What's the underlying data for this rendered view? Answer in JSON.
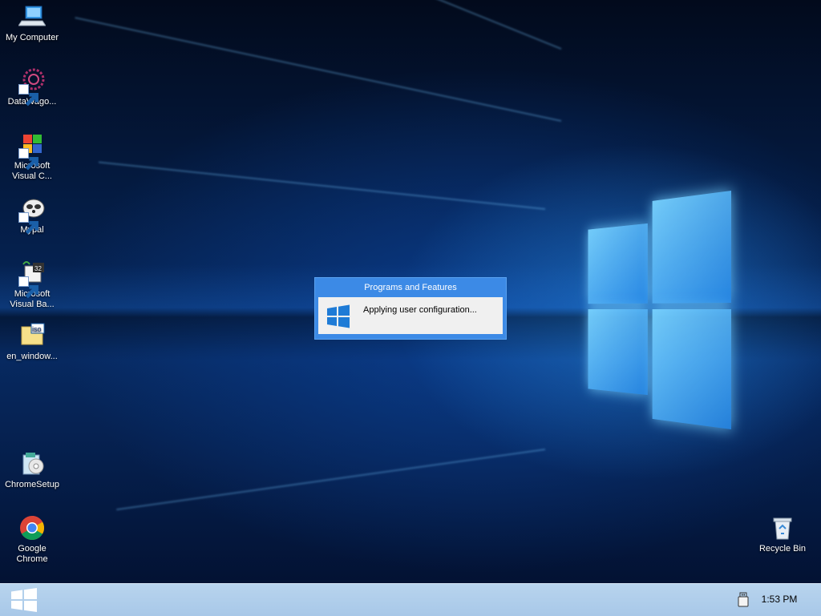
{
  "desktop": {
    "icons": [
      {
        "label": "My Computer",
        "icon": "computer-icon"
      },
      {
        "label": "DataWago...",
        "icon": "datawagon-icon"
      },
      {
        "label": "Microsoft Visual C...",
        "icon": "visual-cpp-icon"
      },
      {
        "label": "Mypal",
        "icon": "mypal-icon"
      },
      {
        "label": "Microsoft Visual Ba...",
        "icon": "visual-basic-icon"
      },
      {
        "label": "en_window...",
        "icon": "iso-file-icon"
      },
      {
        "label": "ChromeSetup",
        "icon": "installer-icon"
      },
      {
        "label": "Google Chrome",
        "icon": "chrome-icon"
      },
      {
        "label": "Recycle Bin",
        "icon": "recycle-bin-icon"
      }
    ]
  },
  "dialog": {
    "title": "Programs and Features",
    "message": "Applying user configuration..."
  },
  "taskbar": {
    "time": "1:53 PM",
    "start_icon": "windows-logo-icon",
    "tray_icon": "usb-drive-icon"
  },
  "colors": {
    "taskbar": "#a8c8e8",
    "dialog_title": "#3c8ae6",
    "accent": "#0078d7"
  }
}
